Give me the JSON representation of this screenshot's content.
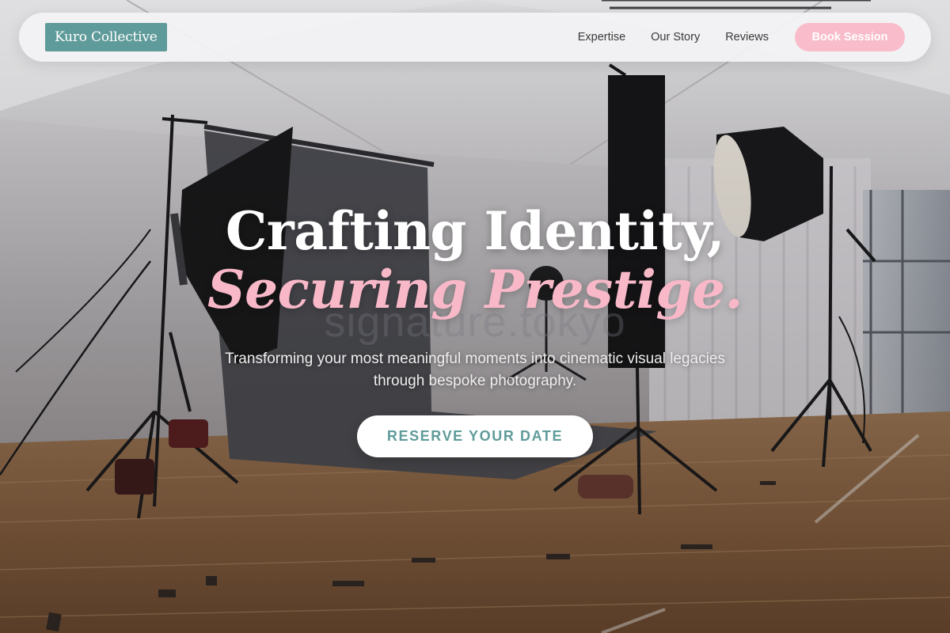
{
  "brand": {
    "name": "Kuro Collective",
    "color": "#5f9b9a"
  },
  "nav": {
    "links": [
      "Expertise",
      "Our Story",
      "Reviews"
    ],
    "cta_label": "Book Session",
    "cta_color": "#f9bcca"
  },
  "hero": {
    "headline_line1": "Crafting Identity,",
    "headline_line2": "Securing Prestige.",
    "accent_color": "#f8b8c8",
    "subheadline": "Transforming your most meaningful moments into cinematic visual legacies through bespoke photography.",
    "cta_label": "RESERVE YOUR DATE",
    "watermark": "signature.tokyo",
    "background": "photo-studio-image"
  }
}
